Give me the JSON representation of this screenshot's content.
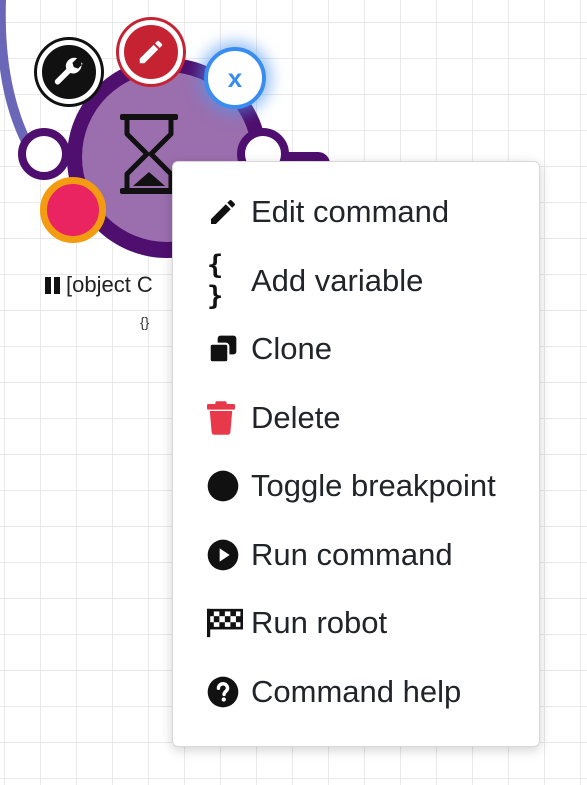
{
  "node": {
    "label": "[object C",
    "sub": "{}",
    "colors": {
      "ring": "#4f0f6e",
      "core": "#9b6fae",
      "breakpoint": "#ea2460",
      "breakpoint_border": "#f39c12",
      "edit": "#c62332",
      "close": "#3a8df0"
    },
    "close_label": "x",
    "icons": [
      "wrench-icon",
      "pencil-icon",
      "hourglass-icon",
      "pause-icon"
    ]
  },
  "context_menu": {
    "items": [
      {
        "label": "Edit command",
        "icon": "pencil-icon"
      },
      {
        "label": "Add variable",
        "icon": "braces-icon",
        "glyph": "{ }"
      },
      {
        "label": "Clone",
        "icon": "clone-icon"
      },
      {
        "label": "Delete",
        "icon": "trash-icon",
        "color": "#e8394a"
      },
      {
        "label": "Toggle breakpoint",
        "icon": "circle-icon"
      },
      {
        "label": "Run command",
        "icon": "play-circle-icon"
      },
      {
        "label": "Run robot",
        "icon": "flag-checkered-icon"
      },
      {
        "label": "Command help",
        "icon": "question-circle-icon"
      }
    ]
  }
}
